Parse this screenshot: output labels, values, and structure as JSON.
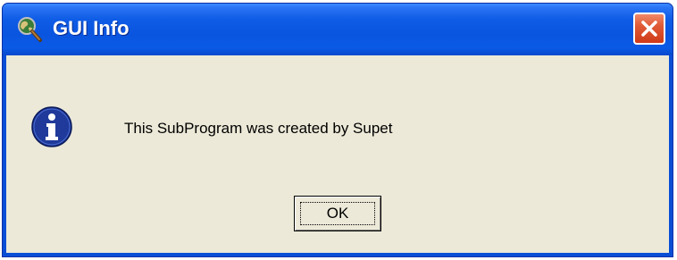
{
  "window": {
    "title": "GUI Info",
    "title_icon": "magnifier-globe-icon",
    "close_icon": "close-icon"
  },
  "dialog": {
    "icon": "info-icon",
    "message": "This SubProgram was created by Supet",
    "ok_label": "OK"
  },
  "colors": {
    "titlebar": "#0a55e0",
    "client_background": "#ece9d8",
    "close_button": "#e05a36",
    "info_icon": "#1f3a9a"
  }
}
